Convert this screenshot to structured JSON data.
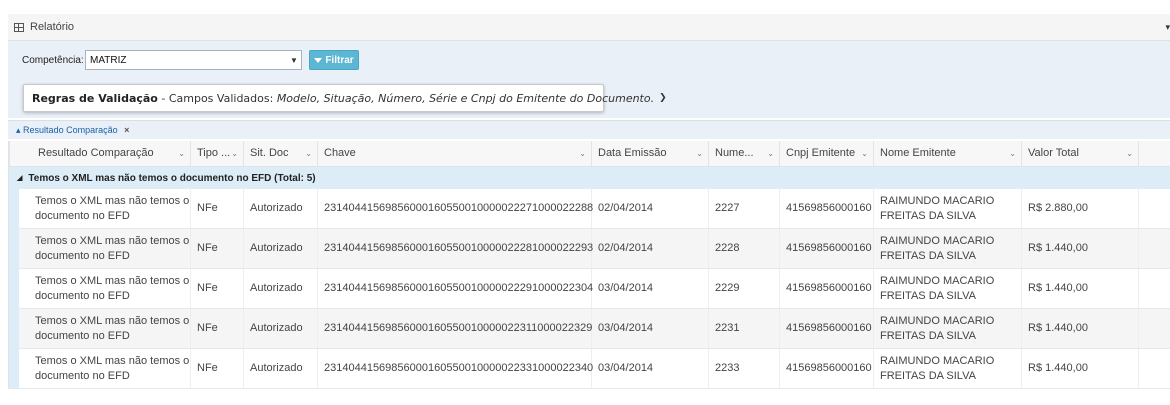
{
  "panel": {
    "title": "Relatório"
  },
  "filter": {
    "competencia_label": "Competência:",
    "competencia_value": "MATRIZ",
    "filter_button": "Filtrar"
  },
  "rules": {
    "title": "Regras de Validação",
    "separator": " - Campos Validados: ",
    "fields": "Modelo, Situação, Número, Série e Cnpj do Emitente do Documento."
  },
  "grouping": {
    "label": "Resultado Comparação"
  },
  "columns": [
    "Resultado Comparação",
    "Tipo ...",
    "Sit. Doc",
    "Chave",
    "Data Emissão",
    "Nume...",
    "Cnpj Emitente",
    "Nome Emitente",
    "Valor Total"
  ],
  "group_header": "Temos o XML mas não temos o documento no EFD (Total: 5)",
  "rows": [
    {
      "resultado": "Temos o XML mas não temos o documento no EFD",
      "tipo": "NFe",
      "sit": "Autorizado",
      "chave": "23140441569856000160550010000022271000022288",
      "data": "02/04/2014",
      "numero": "2227",
      "cnpj": "41569856000160",
      "nome": "RAIMUNDO MACARIO FREITAS DA SILVA",
      "valor": "R$ 2.880,00"
    },
    {
      "resultado": "Temos o XML mas não temos o documento no EFD",
      "tipo": "NFe",
      "sit": "Autorizado",
      "chave": "23140441569856000160550010000022281000022293",
      "data": "02/04/2014",
      "numero": "2228",
      "cnpj": "41569856000160",
      "nome": "RAIMUNDO MACARIO FREITAS DA SILVA",
      "valor": "R$ 1.440,00"
    },
    {
      "resultado": "Temos o XML mas não temos o documento no EFD",
      "tipo": "NFe",
      "sit": "Autorizado",
      "chave": "23140441569856000160550010000022291000022304",
      "data": "03/04/2014",
      "numero": "2229",
      "cnpj": "41569856000160",
      "nome": "RAIMUNDO MACARIO FREITAS DA SILVA",
      "valor": "R$ 1.440,00"
    },
    {
      "resultado": "Temos o XML mas não temos o documento no EFD",
      "tipo": "NFe",
      "sit": "Autorizado",
      "chave": "23140441569856000160550010000022311000022329",
      "data": "03/04/2014",
      "numero": "2231",
      "cnpj": "41569856000160",
      "nome": "RAIMUNDO MACARIO FREITAS DA SILVA",
      "valor": "R$ 1.440,00"
    },
    {
      "resultado": "Temos o XML mas não temos o documento no EFD",
      "tipo": "NFe",
      "sit": "Autorizado",
      "chave": "23140441569856000160550010000022331000022340",
      "data": "03/04/2014",
      "numero": "2233",
      "cnpj": "41569856000160",
      "nome": "RAIMUNDO MACARIO FREITAS DA SILVA",
      "valor": "R$ 1.440,00"
    }
  ]
}
